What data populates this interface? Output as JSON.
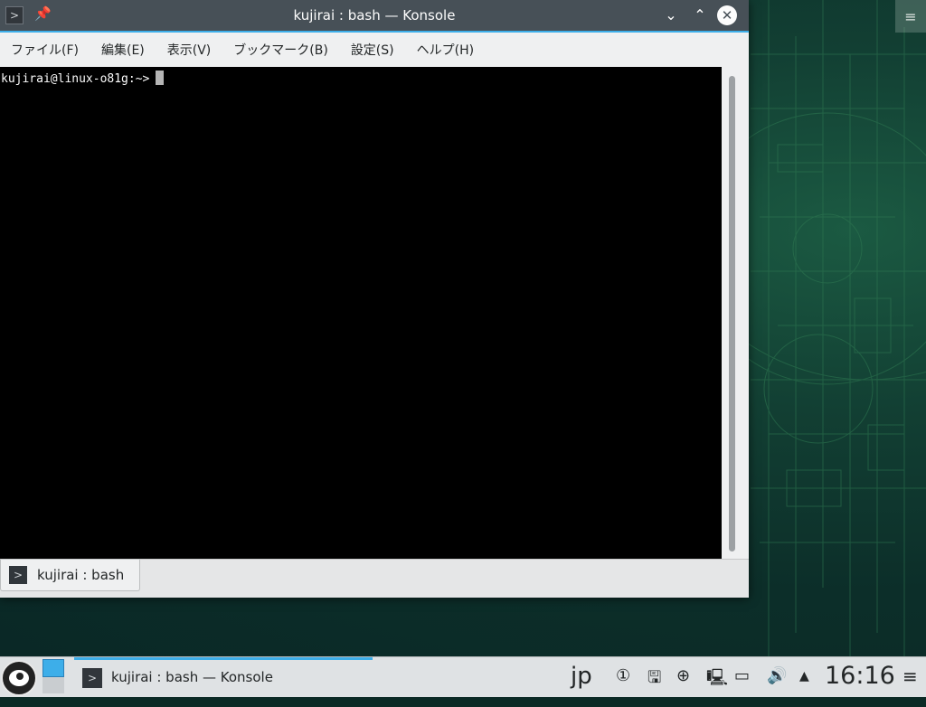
{
  "window": {
    "title": "kujirai : bash — Konsole",
    "app_icon": "terminal-icon",
    "pin_icon": "pin-icon",
    "minimize_icon": "chevron-down-icon",
    "maximize_icon": "chevron-up-icon",
    "close_icon": "close-icon"
  },
  "menubar": {
    "items": [
      {
        "label": "ファイル(F)"
      },
      {
        "label": "編集(E)"
      },
      {
        "label": "表示(V)"
      },
      {
        "label": "ブックマーク(B)"
      },
      {
        "label": "設定(S)"
      },
      {
        "label": "ヘルプ(H)"
      }
    ]
  },
  "terminal": {
    "prompt": "kujirai@linux-o81g:~>",
    "background": "#000000",
    "foreground": "#fcfcfc"
  },
  "tabs": [
    {
      "label": "kujirai : bash",
      "icon": "terminal-icon"
    }
  ],
  "taskbar": {
    "task_label": "kujirai : bash — Konsole",
    "keyboard_layout": "jp",
    "clock": "16:16",
    "tray_icons": [
      "clipboard-icon",
      "usb-icon",
      "update-icon",
      "network-icon",
      "battery-icon",
      "volume-icon",
      "expand-tray-icon"
    ]
  },
  "colors": {
    "accent": "#3daee9",
    "titlebar": "#475057",
    "window_bg": "#eff0f1"
  }
}
